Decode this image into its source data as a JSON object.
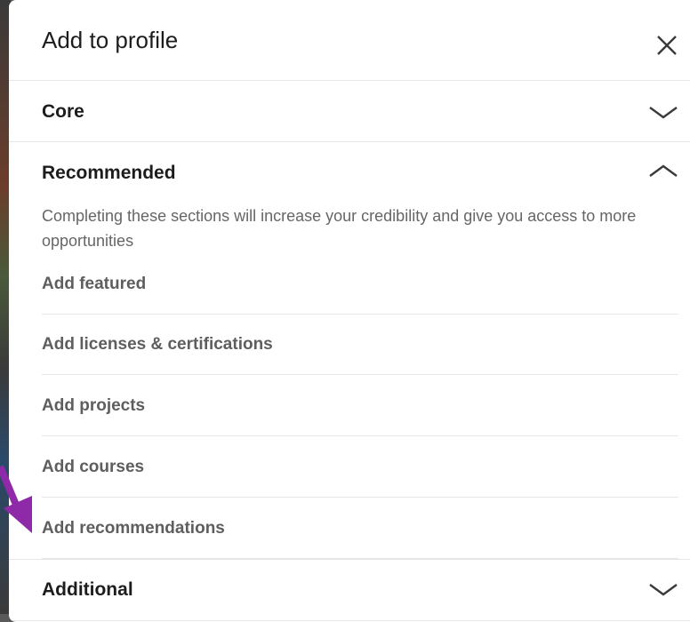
{
  "modal": {
    "title": "Add to profile",
    "close_icon": "close-icon"
  },
  "sections": {
    "core": {
      "label": "Core",
      "state": "collapsed"
    },
    "recommended": {
      "label": "Recommended",
      "state": "expanded",
      "description": "Completing these sections will increase your credibility and give you access to more opportunities",
      "items": [
        {
          "label": "Add featured"
        },
        {
          "label": "Add licenses & certifications"
        },
        {
          "label": "Add projects"
        },
        {
          "label": "Add courses"
        },
        {
          "label": "Add recommendations"
        }
      ]
    },
    "additional": {
      "label": "Additional",
      "state": "collapsed"
    }
  },
  "annotation": {
    "arrow_color": "#8e2aa8"
  }
}
